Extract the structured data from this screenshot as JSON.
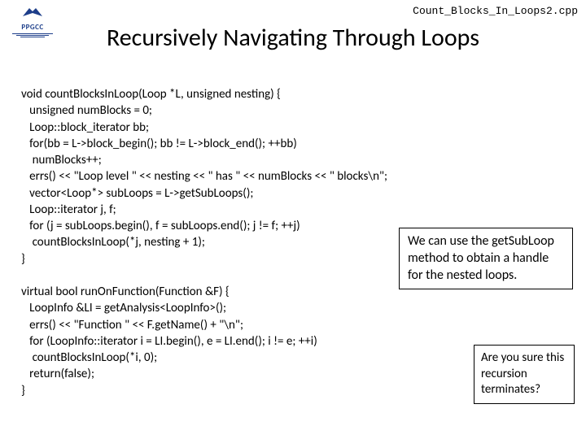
{
  "filename": "Count_Blocks_In_Loops2.cpp",
  "logo_text": "PPGCC",
  "title": "Recursively Navigating Through Loops",
  "code": "void countBlocksInLoop(Loop *L, unsigned nesting) {\n   unsigned numBlocks = 0;\n   Loop::block_iterator bb;\n   for(bb = L->block_begin(); bb != L->block_end(); ++bb)\n    numBlocks++;\n   errs() << \"Loop level \" << nesting << \" has \" << numBlocks << \" blocks\\n\";\n   vector<Loop*> subLoops = L->getSubLoops();\n   Loop::iterator j, f;\n   for (j = subLoops.begin(), f = subLoops.end(); j != f; ++j)\n    countBlocksInLoop(*j, nesting + 1);\n}\n\nvirtual bool runOnFunction(Function &F) {\n   LoopInfo &LI = getAnalysis<LoopInfo>();\n   errs() << \"Function \" << F.getName() + \"\\n\";\n   for (LoopInfo::iterator i = LI.begin(), e = LI.end(); i != e; ++i)\n    countBlocksInLoop(*i, 0);\n   return(false);\n}",
  "callout1": "We can use the getSubLoop method to obtain a handle for the nested loops.",
  "callout2": "Are you sure this recursion terminates?"
}
